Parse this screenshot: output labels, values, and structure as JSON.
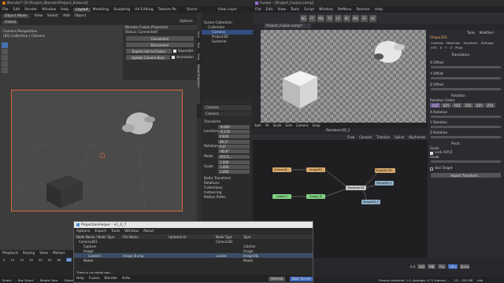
{
  "blender": {
    "title": "Blender* [D:\\Project_Blender\\Project_B.blend]",
    "menu": [
      "File",
      "Edit",
      "Render",
      "Window",
      "Help"
    ],
    "workspaces": [
      "Layout",
      "Modeling",
      "Sculpting",
      "UV Editing",
      "Texture Pa"
    ],
    "scene": "Scene",
    "view_layer": "View Layer",
    "mode": "Object Mode",
    "header_menu": [
      "View",
      "Select",
      "Add",
      "Object"
    ],
    "orientation": "Global",
    "viewport_title": "Camera Perspective",
    "viewport_subtitle": "(65) Collection | Camera",
    "panel_title": "Blender Fusion Projection",
    "status": "Status: Connected!",
    "buttons": [
      "Connection",
      "Disconnect",
      "Export cam to Fusion",
      "Update Camera Keys"
    ],
    "checks": [
      "Separate",
      "Animation"
    ],
    "options_label": "Options",
    "side_tabs": [
      "Item",
      "Tool",
      "View",
      "Fusion Projection"
    ],
    "outliner_title": "Scene Collection",
    "outliner": [
      "Collection",
      "Camera",
      "Project3D",
      "Suzanne"
    ],
    "props_object": "Camera",
    "props_data": "Camera",
    "transform_label": "Transform",
    "location_label": "Location",
    "rotation_label": "Rotation",
    "scale_label": "Scale",
    "mode_label": "Mode",
    "mode_value": "XYZ E...",
    "location": [
      "-6.690",
      "-0.176",
      "4.642"
    ],
    "rotation": [
      "66.3°",
      "0.0°",
      "-85.6°"
    ],
    "scale": [
      "1.000",
      "1.000",
      "1.000"
    ],
    "sections": [
      "Delta Transform",
      "Relations",
      "Collections",
      "Instancing",
      "Motion Paths"
    ],
    "timeline_menu": [
      "Playback",
      "Keying",
      "View",
      "Marker"
    ],
    "frame": "65",
    "ticks": [
      "0",
      "10",
      "20",
      "30",
      "40",
      "50",
      "60",
      "70"
    ],
    "statusbar": [
      "Select",
      "Box Select",
      "Rotate View",
      "Object Context Menu"
    ]
  },
  "fusion": {
    "title": "Fusion - [Project_Fusion.comp]",
    "menu": [
      "File",
      "Edit",
      "View",
      "Tools",
      "Script",
      "Window",
      "PeMenu",
      "Reactor",
      "Help"
    ],
    "toolbar_icons": [
      "BG",
      "FT",
      "MG",
      "TX",
      "CC",
      "BC",
      "MG",
      "SF",
      "XF"
    ],
    "comp_tab": "Project_Fusion.comp*",
    "viewer_label": "Renderer3D_1",
    "viewer_menu": [
      "Split",
      "Fit",
      "Scale",
      "Grid",
      "Camera",
      "Snap"
    ],
    "flow_tabs": [
      "Flow",
      "Console",
      "Timeline",
      "Spline",
      "Keyframes"
    ],
    "nodes": [
      {
        "label": "CameraD...",
        "color": "#d8a86a"
      },
      {
        "label": "Image3D",
        "color": "#d8a86a"
      },
      {
        "label": "Projector3D...",
        "color": "#d8a86a"
      },
      {
        "label": "Renderer3D",
        "color": "#c8c8c8"
      },
      {
        "label": "Merge3D_1",
        "color": "#8fb0c8"
      },
      {
        "label": "Shape3D_1",
        "color": "#8fb0c8"
      },
      {
        "label": "Loader1",
        "color": "#7fd07f"
      },
      {
        "label": "Image_B",
        "color": "#7fd07f"
      }
    ],
    "inspector_tabs": [
      "Tools",
      "Modifiers"
    ],
    "inspector_node": "Shape3D1",
    "inspector_sub": [
      "Controls",
      "Materials",
      "Transform",
      "Settings"
    ],
    "inspector_row": [
      "XYZ",
      "X",
      "Y",
      "Z",
      "Pivot"
    ],
    "translation": "Translation",
    "x_offset": "X Offset",
    "y_offset": "Y Offset",
    "z_offset": "Z Offset",
    "rotation_label": "Rotation",
    "rotation_order": "Rotation Order",
    "rotation_order_options": [
      "XYZ",
      "XZY",
      "YXZ",
      "YZX",
      "ZXY",
      "ZYX"
    ],
    "x_rot": "X Rotation",
    "y_rot": "Y Rotation",
    "z_rot": "Z Rotation",
    "pivot": "Pivot",
    "scale": "Scale",
    "lock_xyz": "Lock X/Y/Z",
    "scale_label": "Scale",
    "use_target": "Use Target",
    "import_transform": "Import Transform...",
    "statusbar": "Frames rendered: 1.0,  Average: 4.71 frames/...",
    "status_right": "1% - 255 MB",
    "idle": "Idle",
    "frame": "0.0",
    "transport": [
      "HiQ",
      "MB",
      "Prx",
      "APrx",
      "Some"
    ]
  },
  "helper": {
    "title": "ProjectionHelper - v1_0_7",
    "menu": [
      "Options",
      "Export",
      "Tools",
      "Window",
      "About"
    ],
    "columns": [
      "Node Name / Node Type",
      "File Name",
      "Updated at",
      "Node Type",
      "Type"
    ],
    "rows": [
      {
        "name": "Camera3D1",
        "file": "",
        "node_type": "Camera3D",
        "type": ""
      },
      {
        "name": "Capture",
        "file": "",
        "node_type": "",
        "type": "Catcher"
      },
      {
        "name": "Image",
        "file": "",
        "node_type": "",
        "type": "Image"
      },
      {
        "name": "Loader1",
        "file": "Image_B.png",
        "node_type": "Loader",
        "type": "ImageObj"
      },
      {
        "name": "Model",
        "file": "",
        "node_type": "",
        "type": "Model"
      }
    ],
    "message": "There is no modal ope...",
    "footer_tabs": [
      "Help",
      "Fusion",
      "Blender",
      "Krita"
    ],
    "refresh": "Refresh",
    "start_server": "Start Server"
  }
}
